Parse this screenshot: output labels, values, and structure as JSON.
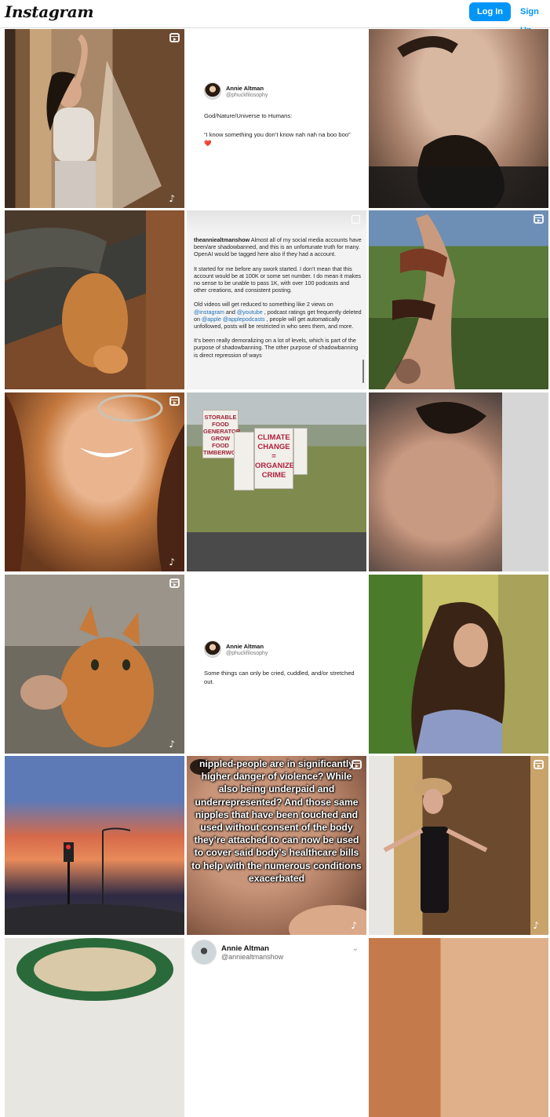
{
  "header": {
    "logo": "Instagram",
    "login_label": "Log In",
    "signup_label": "Sign Up"
  },
  "tweet1": {
    "name": "Annie Altman",
    "handle": "@phuckfilosophy",
    "line1": "God/Nature/Universe to Humans:",
    "line2": "“I know something you don’t know nah nah na boo boo”",
    "heart": "❤️"
  },
  "caption": {
    "username": "theanniealtmanshow",
    "p1": " Almost all of my social media accounts have been/are shadowbanned, and this is an unfortunate truth for many. OpenAI would be tagged here also if they had a account.",
    "p2": "It started for me before any swork started. I don’t mean that this account would be at 100K or some set number. I do mean it makes no sense to be unable to pass 1K, with over 100 podcasts and other creations, and consistent posting.",
    "p3a": "Old videos will get reduced to something like 2 views on ",
    "mention_instagram": "@instagram",
    "p3b": " and ",
    "mention_youtube": "@youtube",
    "p3c": " , podcast ratings get frequently deleted on ",
    "mention_apple": "@apple",
    "mention_applepodcasts": "@applepodcasts",
    "p3d": " , people will get automatically unfollowed, posts will be restricted in who sees them, and more.",
    "p4": "It’s been really demoralizing on a lot of levels, which is part of the purpose of shadowbanning. The other purpose of shadowbanning is direct repression of ways"
  },
  "signs": {
    "sign1": "STORABLE FOOD GENERATOR GROW FOOD TIMBERWOLF",
    "sign2": "CLIMATE CHANGE = ORGANIZED CRIME"
  },
  "tweet2": {
    "name": "Annie Altman",
    "handle": "@phuckfilosophy",
    "text": "Some things can only be cried, cuddled, and/or stretched out."
  },
  "overlay": {
    "text": "nippled-people are in significantly higher danger of violence? While also being underpaid and underrepresented? And those same nipples that have been touched and used without consent of the body they’re attached to can now be used to cover said body’s healthcare bills to help with the numerous conditions exacerbated"
  },
  "profile_card": {
    "name": "Annie Altman",
    "handle": "@anniealtmanshow"
  },
  "tiktok_glyph": "♪"
}
